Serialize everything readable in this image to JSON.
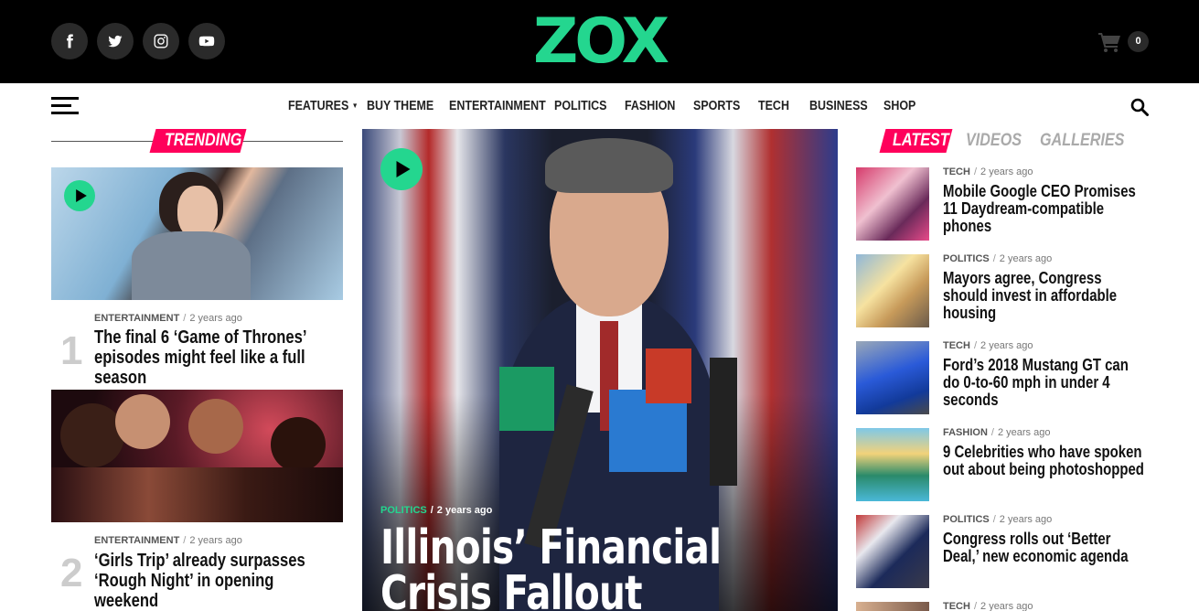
{
  "brand": {
    "logo": "ZOX",
    "accent_color": "#24d68f",
    "pink_color": "#ff005b"
  },
  "social": [
    {
      "icon": "facebook-icon"
    },
    {
      "icon": "twitter-icon"
    },
    {
      "icon": "instagram-icon"
    },
    {
      "icon": "youtube-icon"
    }
  ],
  "cart": {
    "icon": "shopping-cart-icon",
    "count": "0"
  },
  "nav": {
    "menu_icon": "hamburger-menu-icon",
    "search_icon": "search-icon",
    "items": [
      {
        "label": "FEATURES",
        "has_dropdown": true
      },
      {
        "label": "BUY THEME"
      },
      {
        "label": "ENTERTAINMENT"
      },
      {
        "label": "POLITICS"
      },
      {
        "label": "FASHION"
      },
      {
        "label": "SPORTS"
      },
      {
        "label": "TECH"
      },
      {
        "label": "BUSINESS"
      },
      {
        "label": "SHOP"
      }
    ]
  },
  "trending": {
    "heading": "TRENDING",
    "items": [
      {
        "rank": "1",
        "category": "ENTERTAINMENT",
        "time": "2 years ago",
        "title": "The final 6 ‘Game of Thrones’ episodes might feel like a full season",
        "has_video": true
      },
      {
        "rank": "2",
        "category": "ENTERTAINMENT",
        "time": "2 years ago",
        "title": "‘Girls Trip’ already surpasses ‘Rough Night’ in opening weekend",
        "has_video": false
      }
    ]
  },
  "feature": {
    "category": "POLITICS",
    "time": "2 years ago",
    "title": "Illinois’ Financial Crisis Fallout",
    "has_video": true
  },
  "latest": {
    "tabs": [
      "LATEST",
      "VIDEOS",
      "GALLERIES"
    ],
    "active_tab": "LATEST",
    "items": [
      {
        "category": "TECH",
        "time": "2 years ago",
        "title": "Mobile Google CEO Promises 11 Daydream-compatible phones"
      },
      {
        "category": "POLITICS",
        "time": "2 years ago",
        "title": "Mayors agree, Congress should invest in affordable housing"
      },
      {
        "category": "TECH",
        "time": "2 years ago",
        "title": "Ford’s 2018 Mustang GT can do 0-to-60 mph in under 4 seconds"
      },
      {
        "category": "FASHION",
        "time": "2 years ago",
        "title": "9 Celebrities who have spoken out about being photoshopped"
      },
      {
        "category": "POLITICS",
        "time": "2 years ago",
        "title": "Congress rolls out ‘Better Deal,’ new economic agenda"
      },
      {
        "category": "TECH",
        "time": "2 years ago",
        "title": ""
      }
    ]
  }
}
